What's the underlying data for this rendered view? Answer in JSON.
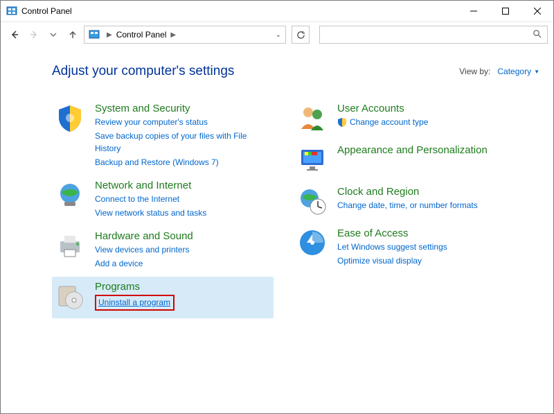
{
  "titlebar": {
    "title": "Control Panel"
  },
  "nav": {
    "breadcrumb_root": "Control Panel"
  },
  "header": {
    "heading": "Adjust your computer's settings",
    "view_by_label": "View by:",
    "view_by_value": "Category"
  },
  "left_categories": [
    {
      "id": "system-security",
      "title": "System and Security",
      "links": [
        "Review your computer's status",
        "Save backup copies of your files with File History",
        "Backup and Restore (Windows 7)"
      ]
    },
    {
      "id": "network-internet",
      "title": "Network and Internet",
      "links": [
        "Connect to the Internet",
        "View network status and tasks"
      ]
    },
    {
      "id": "hardware-sound",
      "title": "Hardware and Sound",
      "links": [
        "View devices and printers",
        "Add a device"
      ]
    },
    {
      "id": "programs",
      "title": "Programs",
      "links": [
        "Uninstall a program"
      ],
      "selected": true,
      "highlight_link": 0
    }
  ],
  "right_categories": [
    {
      "id": "user-accounts",
      "title": "User Accounts",
      "links": [
        "Change account type"
      ],
      "shield_links": [
        0
      ]
    },
    {
      "id": "appearance",
      "title": "Appearance and Personalization",
      "links": []
    },
    {
      "id": "clock-region",
      "title": "Clock and Region",
      "links": [
        "Change date, time, or number formats"
      ]
    },
    {
      "id": "ease-of-access",
      "title": "Ease of Access",
      "links": [
        "Let Windows suggest settings",
        "Optimize visual display"
      ]
    }
  ]
}
